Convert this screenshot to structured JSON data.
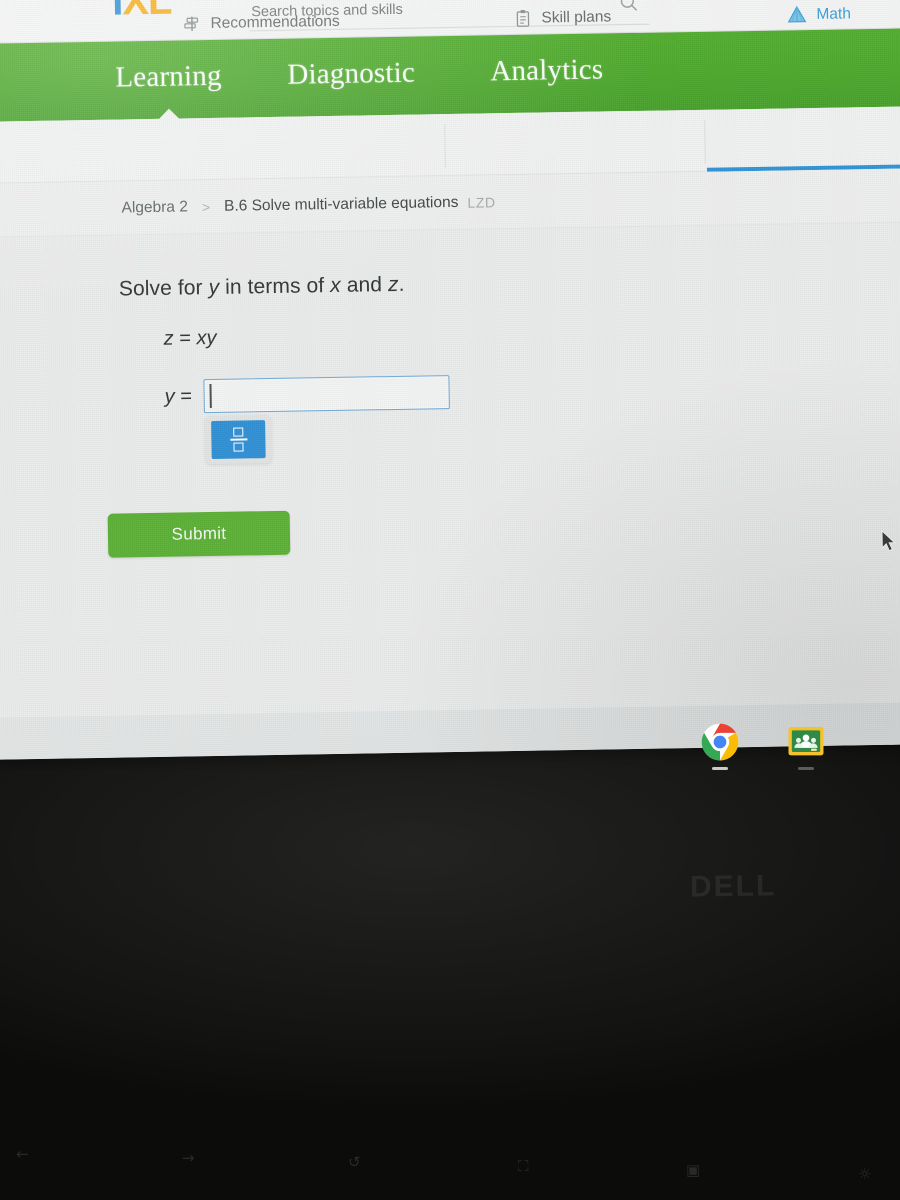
{
  "brand": {
    "logo_i": "I",
    "logo_xl": "XL",
    "accent_green": "#4CA82C",
    "accent_blue": "#2F93D6",
    "submit_green": "#5BB036"
  },
  "search": {
    "placeholder": "Search topics and skills",
    "value": "",
    "icon": "search-icon"
  },
  "primary_nav": {
    "items": [
      {
        "label": "Learning",
        "active": true
      },
      {
        "label": "Diagnostic",
        "active": false
      },
      {
        "label": "Analytics",
        "active": false
      }
    ]
  },
  "sub_nav": {
    "items": [
      {
        "label": "Recommendations",
        "icon": "signpost-icon",
        "active": false
      },
      {
        "label": "Skill plans",
        "icon": "clipboard-list-icon",
        "active": false
      },
      {
        "label": "Math",
        "icon": "pyramid-icon",
        "active": true
      }
    ]
  },
  "breadcrumb": {
    "course": "Algebra 2",
    "separator": ">",
    "skill": "B.6 Solve multi-variable equations",
    "skill_code": "LZD"
  },
  "question": {
    "prompt_part1": "Solve for ",
    "prompt_var1": "y",
    "prompt_part2": " in terms of ",
    "prompt_var2": "x",
    "prompt_part3": " and ",
    "prompt_var3": "z",
    "prompt_part4": ".",
    "given_lhs": "z",
    "given_eq": " = ",
    "given_rhs": "xy",
    "answer_label_var": "y",
    "answer_label_eq": " =",
    "answer_value": "",
    "answer_placeholder": "",
    "keypad_button": "fraction-button",
    "submit_label": "Submit"
  },
  "shelf": {
    "apps": [
      {
        "name": "Google Chrome",
        "icon": "chrome-icon",
        "running": true
      },
      {
        "name": "Google Classroom",
        "icon": "classroom-icon",
        "running": true
      }
    ]
  },
  "device": {
    "brand_mark": "DELL",
    "function_keys": [
      "back",
      "forward",
      "reload",
      "fullscreen",
      "overview",
      "brightness"
    ]
  }
}
